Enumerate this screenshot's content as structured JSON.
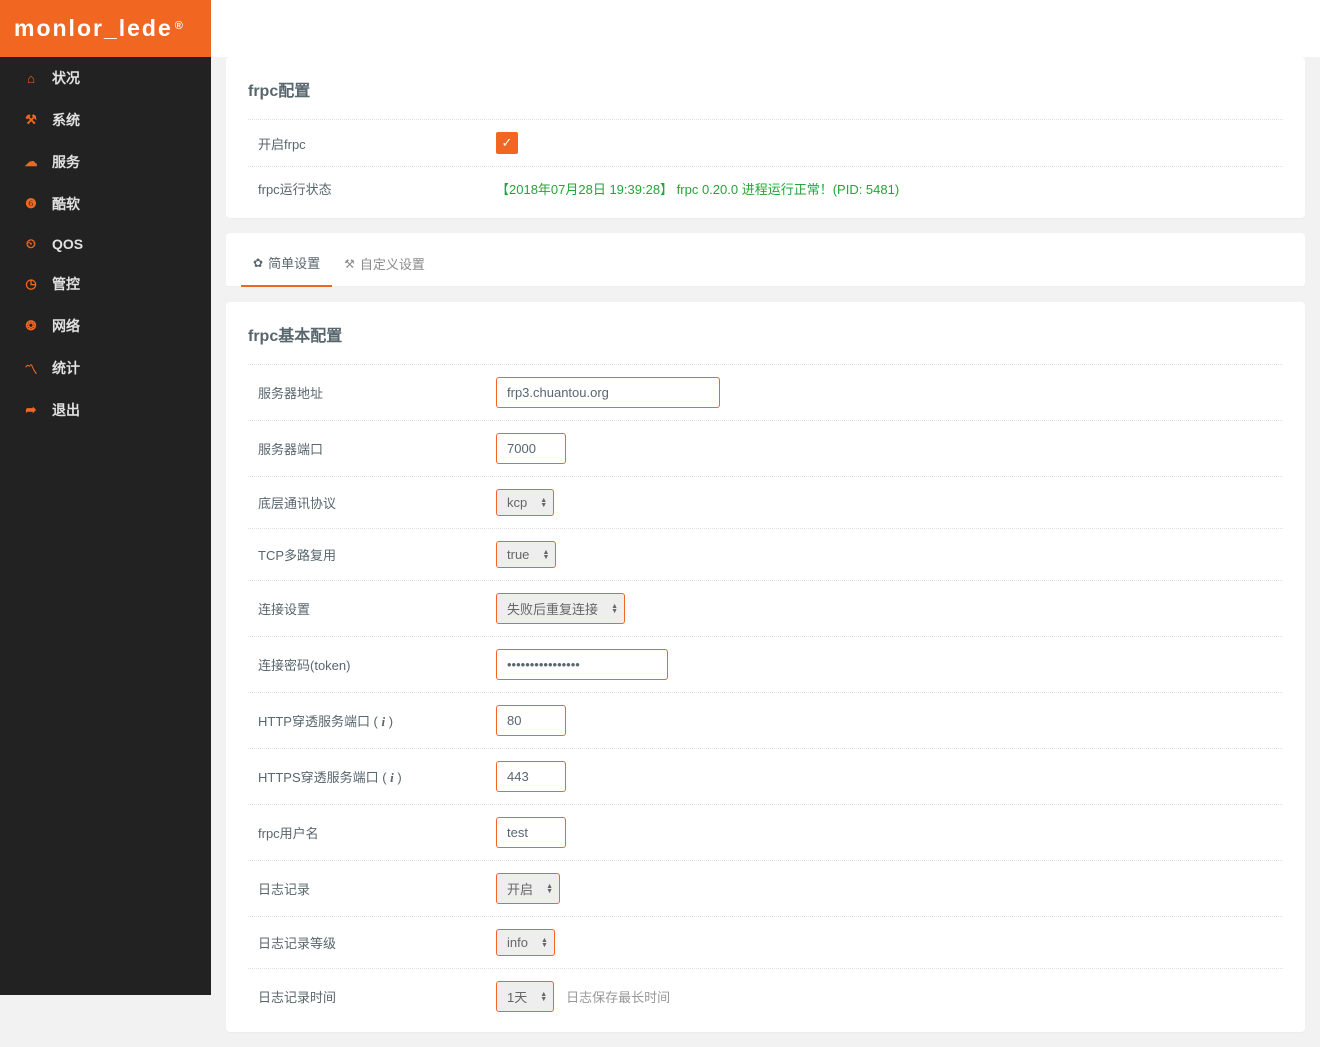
{
  "brand": "monlor_lede",
  "brand_sup": "®",
  "sidebar": {
    "items": [
      {
        "icon": "home-icon",
        "glyph": "⌂",
        "label": "状况"
      },
      {
        "icon": "tools-icon",
        "glyph": "⚒",
        "label": "系统"
      },
      {
        "icon": "cloud-icon",
        "glyph": "☁",
        "label": "服务"
      },
      {
        "icon": "weibo-icon",
        "glyph": "❻",
        "label": "酷软"
      },
      {
        "icon": "dashboard-icon",
        "glyph": "⏲",
        "label": "QOS"
      },
      {
        "icon": "clock-icon",
        "glyph": "◷",
        "label": "管控"
      },
      {
        "icon": "globe-icon",
        "glyph": "❂",
        "label": "网络"
      },
      {
        "icon": "chart-icon",
        "glyph": "〽",
        "label": "统计"
      },
      {
        "icon": "logout-icon",
        "glyph": "➦",
        "label": "退出"
      }
    ]
  },
  "panel1": {
    "title": "frpc配置",
    "enable_label": "开启frpc",
    "status_label": "frpc运行状态",
    "status_text": "【2018年07月28日 19:39:28】  frpc 0.20.0 进程运行正常！(PID: 5481)"
  },
  "tabs": {
    "simple": "简单设置",
    "custom": "自定义设置"
  },
  "panel2": {
    "title": "frpc基本配置",
    "server_addr_label": "服务器地址",
    "server_addr_value": "frp3.chuantou.org",
    "server_port_label": "服务器端口",
    "server_port_value": "7000",
    "protocol_label": "底层通讯协议",
    "protocol_value": "kcp",
    "tcp_mux_label": "TCP多路复用",
    "tcp_mux_value": "true",
    "conn_setting_label": "连接设置",
    "conn_setting_value": "失败后重复连接",
    "token_label": "连接密码(token)",
    "token_value": "••••••••••••••••",
    "http_port_label_pre": "HTTP穿透服务端口 ( ",
    "http_port_label_post": " )",
    "http_port_value": "80",
    "https_port_label_pre": "HTTPS穿透服务端口 ( ",
    "https_port_label_post": " )",
    "https_port_value": "443",
    "user_label": "frpc用户名",
    "user_value": "test",
    "log_label": "日志记录",
    "log_value": "开启",
    "log_level_label": "日志记录等级",
    "log_level_value": "info",
    "log_days_label": "日志记录时间",
    "log_days_value": "1天",
    "log_days_hint": "日志保存最长时间",
    "info_i": "i"
  }
}
